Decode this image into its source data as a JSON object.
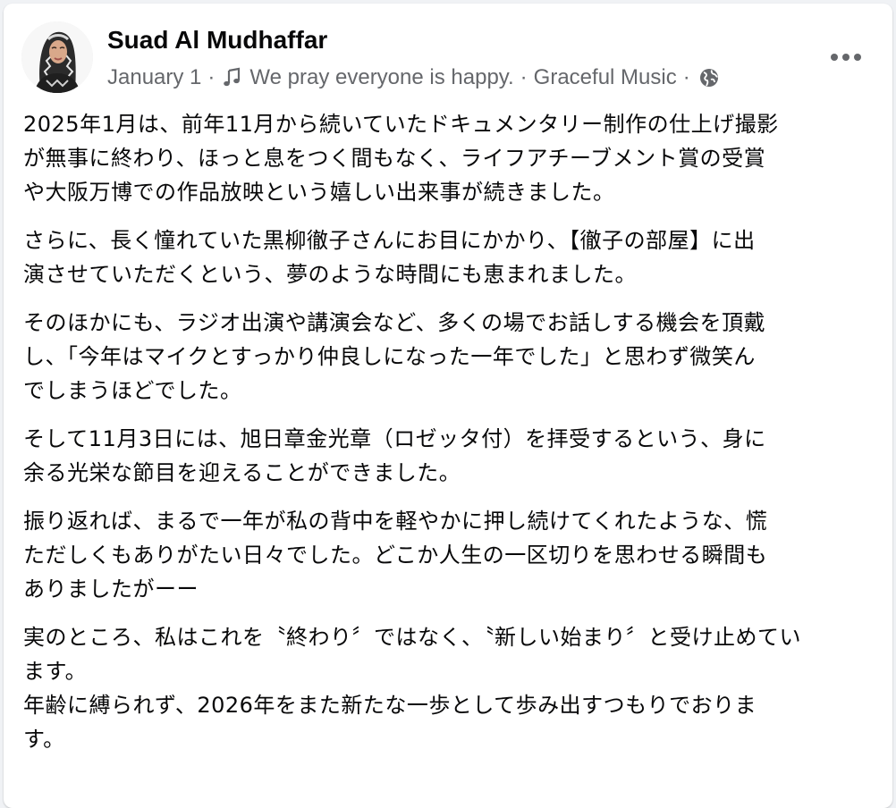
{
  "post": {
    "author": "Suad Al Mudhaffar",
    "date": "January 1",
    "music_title": "We pray everyone is happy.",
    "music_artist": "Graceful Music",
    "separator": "·",
    "audience_icon": "globe-icon",
    "more_icon": "more-options-icon",
    "paragraphs": [
      "2025年1月は、前年11月から続いていたドキュメンタリー制作の仕上げ撮影\nが無事に終わり、ほっと息をつく間もなく、ライフアチーブメント賞の受賞\nや大阪万博での作品放映という嬉しい出来事が続きました。",
      "さらに、長く憧れていた黒柳徹子さんにお目にかかり、【徹子の部屋】に出\n演させていただくという、夢のような時間にも恵まれました。",
      "そのほかにも、ラジオ出演や講演会など、多くの場でお話しする機会を頂戴\nし、「今年はマイクとすっかり仲良しになった一年でした」と思わず微笑ん\nでしまうほどでした。",
      "そして11月3日には、旭日章金光章（ロゼッタ付）を拝受するという、身に\n余る光栄な節目を迎えることができました。",
      "振り返れば、まるで一年が私の背中を軽やかに押し続けてくれたような、慌\nただしくもありがたい日々でした。どこか人生の一区切りを思わせる瞬間も\nありましたがーー",
      "実のところ、私はこれを〝終わり〞ではなく、〝新しい始まり〞と受け止めてい\nます。\n年齢に縛られず、2026年をまた新たな一歩として歩み出すつもりでおりま\nす。"
    ]
  }
}
